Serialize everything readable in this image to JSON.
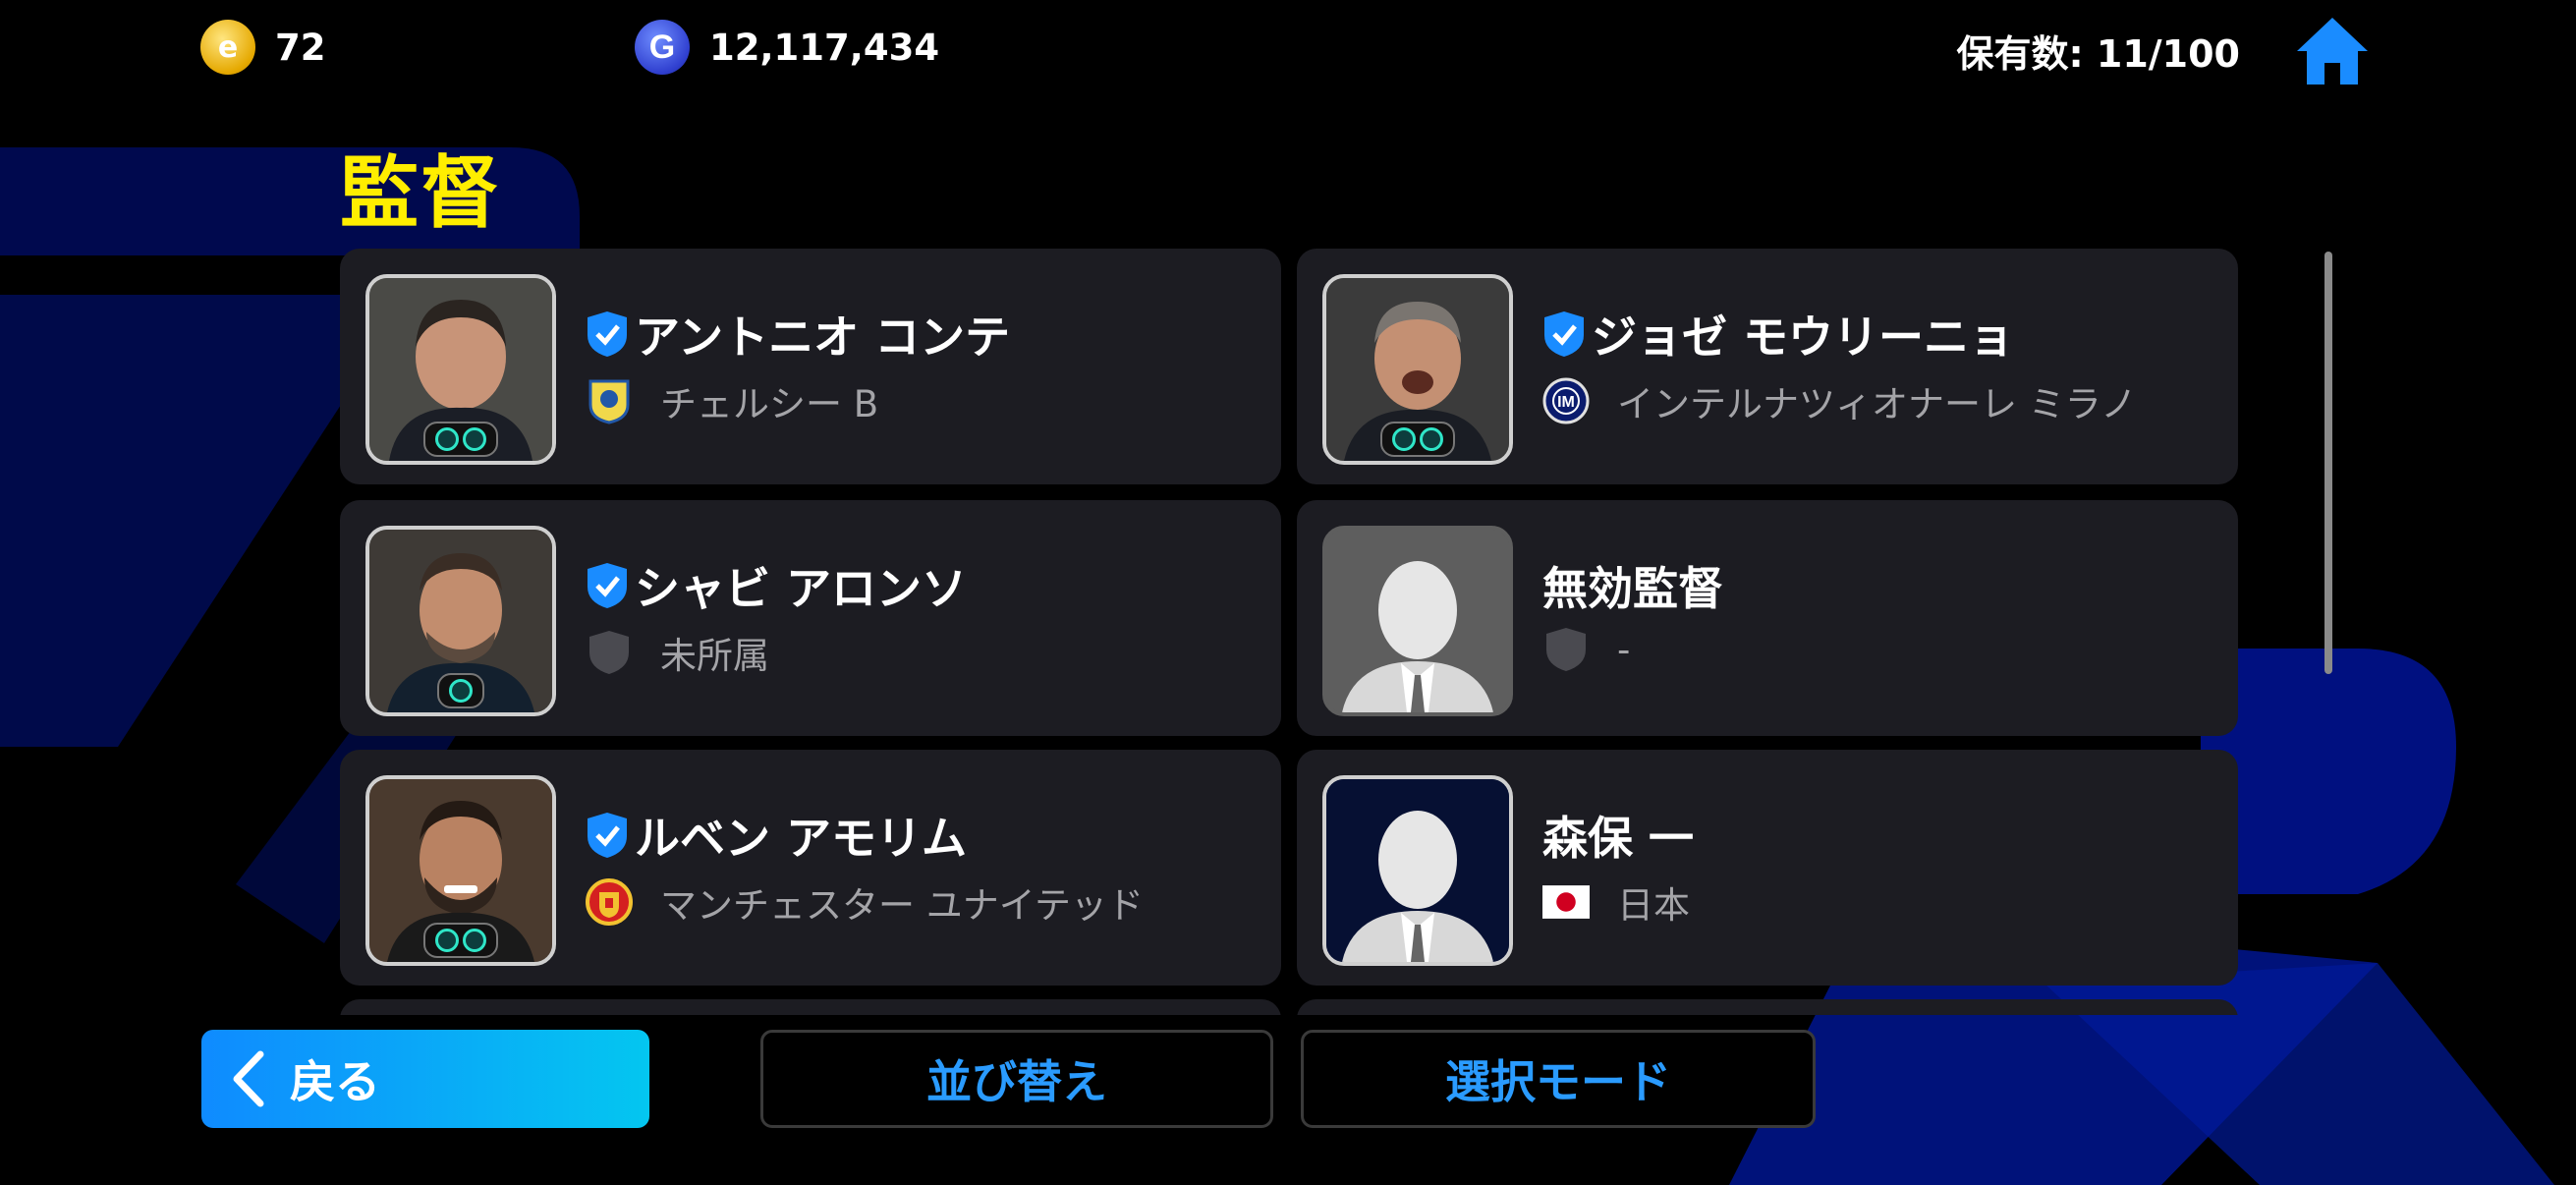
{
  "currencies": {
    "coins": "72",
    "gp": "12,117,434",
    "coin_icon_glyph": "e",
    "gp_icon_glyph": "G"
  },
  "owned": "保有数: 11/100",
  "title": "監督",
  "managers": [
    {
      "name": "アントニオ コンテ",
      "team": "チェルシー B",
      "team_icon": "chelsea-crest-icon",
      "photo_tone": "#4a4a46",
      "badges": 2,
      "featured": true
    },
    {
      "name": "ジョゼ モウリーニョ",
      "team": "インテルナツィオナーレ ミラノ",
      "team_icon": "inter-crest-icon",
      "photo_tone": "#3b3b3b",
      "badges": 2,
      "featured": true
    },
    {
      "name": "シャビ アロンソ",
      "team": "未所属",
      "team_icon": "grey-shield-icon",
      "photo_tone": "#3e3a36",
      "badges": 1,
      "featured": true
    },
    {
      "name": "無効監督",
      "team": "-",
      "team_icon": "grey-shield-icon",
      "photo_tone": "#5e5e5e",
      "badges": 0,
      "featured": false
    },
    {
      "name": "ルベン アモリム",
      "team": "マンチェスター ユナイテッド",
      "team_icon": "man-utd-crest-icon",
      "photo_tone": "#4a3a2e",
      "badges": 2,
      "featured": true
    },
    {
      "name": "森保 一",
      "team": "日本",
      "team_icon": "japan-flag-icon",
      "photo_tone": "#061033",
      "badges": 0,
      "featured": false
    }
  ],
  "buttons": {
    "back": "戻る",
    "sort": "並び替え",
    "select_mode": "選択モード"
  },
  "colors": {
    "accent_blue": "#1a8cff",
    "title_yellow": "#ffee00",
    "card_bg": "#1c1c22"
  }
}
